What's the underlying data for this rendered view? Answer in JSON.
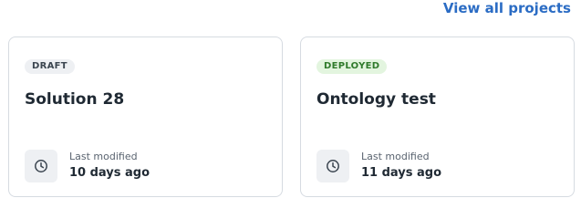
{
  "header": {
    "view_all_label": "View all projects"
  },
  "projects": [
    {
      "status": "DRAFT",
      "title": "Solution 28",
      "modified_label": "Last modified",
      "modified_value": "10 days ago"
    },
    {
      "status": "DEPLOYED",
      "title": "Ontology test",
      "modified_label": "Last modified",
      "modified_value": "11 days ago"
    }
  ],
  "icons": {
    "clock": "clock-icon"
  },
  "colors": {
    "link": "#2b6cc4",
    "draft_badge_bg": "#eef0f3",
    "deployed_badge_bg": "#e3f5df",
    "deployed_badge_text": "#2f7a2b",
    "card_border": "#d6dbe1"
  }
}
